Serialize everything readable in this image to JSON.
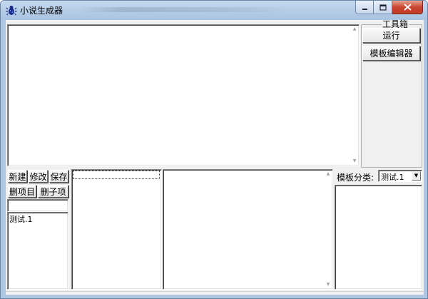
{
  "window": {
    "title": "小说生成器"
  },
  "toolbox": {
    "group_label": "工具箱",
    "run_label": "运行",
    "template_editor_label": "模板编辑器"
  },
  "project_panel": {
    "new_label": "新建",
    "edit_label": "修改",
    "save_label": "保存",
    "delete_project_label": "删项目",
    "delete_child_label": "删子项",
    "items": [
      "测试.1"
    ]
  },
  "template_panel": {
    "category_label": "模板分类:",
    "category_value": "测试.1"
  },
  "icons": {
    "app": "bug-icon",
    "minimize": "minimize-icon",
    "maximize": "maximize-icon",
    "close": "close-icon",
    "dropdown": "chevron-down-icon",
    "scroll_up": "scroll-up-icon",
    "scroll_down": "scroll-down-icon"
  },
  "colors": {
    "titlebar": "#aec6e2",
    "close_button": "#c9462f",
    "client_background": "#f0f0f0"
  }
}
